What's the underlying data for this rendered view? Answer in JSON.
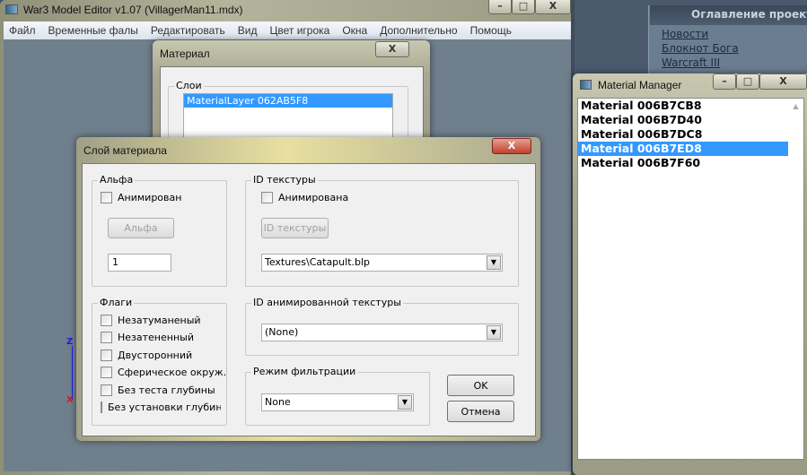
{
  "main_window": {
    "title": "War3 Model Editor v1.07 (VillagerMan11.mdx)",
    "menu": [
      "Файл",
      "Временные фалы",
      "Редактировать",
      "Вид",
      "Цвет игрока",
      "Окна",
      "Дополнительно",
      "Помощь"
    ],
    "axis_z": "Z",
    "axis_x": "X"
  },
  "website": {
    "heading": "Оглавление проекта",
    "links": [
      "Новости",
      "Блокнот Бога",
      "Warcraft III"
    ]
  },
  "material_window": {
    "title": "Материал",
    "layers_group": "Слои",
    "layers": [
      "MaterialLayer 062AB5F8"
    ]
  },
  "material_manager": {
    "title": "Material Manager",
    "items": [
      "Material 006B7CB8",
      "Material 006B7D40",
      "Material 006B7DC8",
      "Material 006B7ED8",
      "Material 006B7F60"
    ],
    "selected_index": 3
  },
  "layer_dialog": {
    "title": "Слой материала",
    "alpha": {
      "group": "Альфа",
      "animated_label": "Анимирован",
      "animated": false,
      "button": "Альфа",
      "value": "1"
    },
    "texture_id": {
      "group": "ID текстуры",
      "animated_label": "Анимирована",
      "animated": false,
      "button": "ID текстуры",
      "selected": "Textures\\Catapult.blp"
    },
    "flags": {
      "group": "Флаги",
      "items": [
        "Незатуманеный",
        "Незатененный",
        "Двусторонний",
        "Сферическое окруж.",
        "Без теста глубины",
        "Без установки глубины"
      ]
    },
    "anim_texture_id": {
      "group": "ID анимированной текстуры",
      "selected": "(None)"
    },
    "filter_mode": {
      "group": "Режим фильтрации",
      "selected": "None"
    },
    "ok": "OK",
    "cancel": "Отмена"
  },
  "captions": {
    "minimize": "–",
    "maximize": "□",
    "close": "X"
  }
}
